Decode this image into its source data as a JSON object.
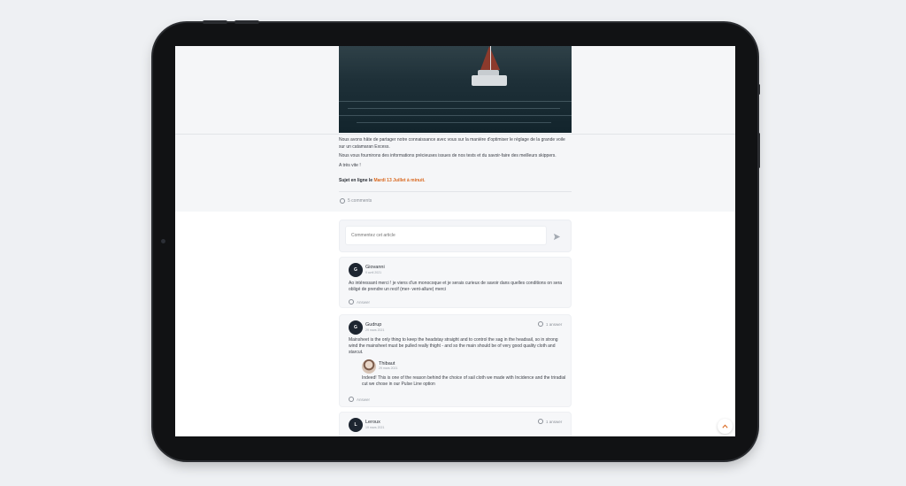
{
  "article": {
    "paragraphs": [
      "Nous avons hâte de partager notre connaissance avec vous sur la manière d'optimiser le réglage de la grande voile sur un catamaran Excess.",
      "Nous vous fournirons des informations précieuses issues de nos tests et du savoir-faire des meilleurs skippers.",
      "A très vite !"
    ],
    "online_prefix": "Sujet en ligne le ",
    "online_date": "Mardi 13 Juillet à minuit."
  },
  "comments_count": "5 comments",
  "compose": {
    "placeholder": "Commentez cet article"
  },
  "comments": [
    {
      "initial": "G",
      "author": "Giovanni",
      "date": "9 avril 2021",
      "text": "Ao intéressant merci ! je viens d'un monocoque et je serais curieux de savoir dans quelles conditions on sera obligé de prendre un recif (mer- vent-allure) merci",
      "answer_label": "Answer"
    },
    {
      "initial": "G",
      "author": "Gudrup",
      "date": "29 mars 2021",
      "reply_count": "1 answer",
      "text": "Mainsheet is the only thing to keep the headstay straight and to control the sag in the headsail, so in strong wind the mainsheet must be pulled really thight - and so the main should be of very good quality cloth and starcut.",
      "answer_label": "Answer",
      "reply": {
        "author": "Thibaut",
        "date": "29 mars 2021",
        "text": "Indeed! This is one of the reason behind the choice of sail cloth we made with Incidence and the triradial cut we chose in our Pulse Line option"
      }
    },
    {
      "initial": "L",
      "author": "Leroux",
      "date": "19 mars 2021",
      "reply_count": "1 answer"
    }
  ],
  "colors": {
    "accent": "#d9681f",
    "avatar_bg": "#1d2530",
    "device": "#111214"
  },
  "icons": {
    "comment": "comment-bubble-icon",
    "send": "send-icon",
    "scroll_top": "chevron-up-icon"
  }
}
